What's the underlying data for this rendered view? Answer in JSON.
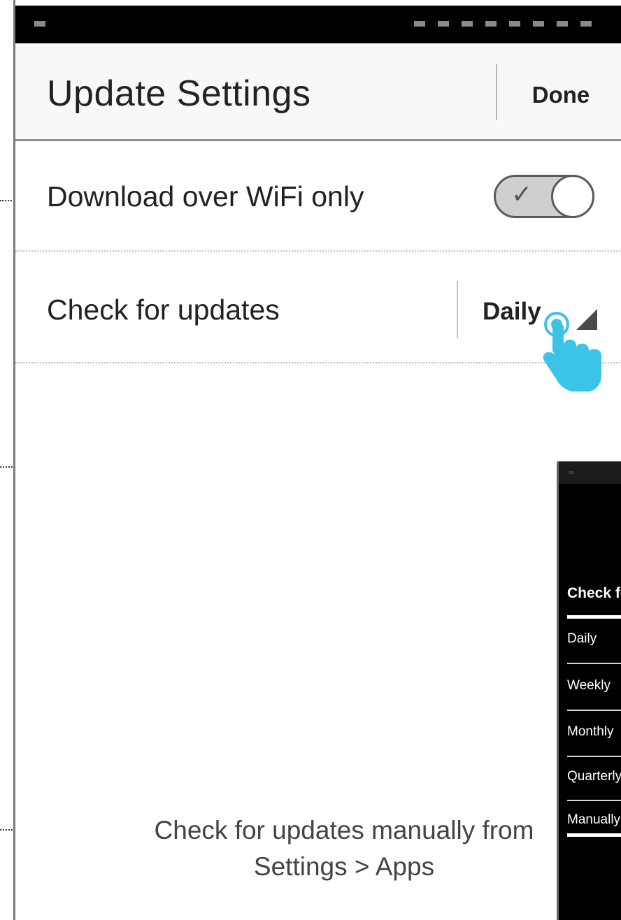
{
  "header": {
    "title": "Update Settings",
    "done_label": "Done"
  },
  "settings": {
    "wifi_label": "Download over WiFi only",
    "wifi_enabled": true,
    "check_label": "Check for updates",
    "check_value": "Daily"
  },
  "footer": {
    "note_line1": "Check for updates manually from",
    "note_line2": "Settings > Apps"
  },
  "picker_preview": {
    "title": "Check for updates",
    "options": [
      "Daily",
      "Weekly",
      "Monthly",
      "Quarterly",
      "Manually"
    ]
  },
  "colors": {
    "pointer_hand": "#3cc3e8",
    "status_bar": "#000000"
  },
  "icons": {
    "toggle_check": "check-icon",
    "select_arrow": "dropdown-arrow-icon",
    "pointer": "hand-pointer-icon"
  }
}
